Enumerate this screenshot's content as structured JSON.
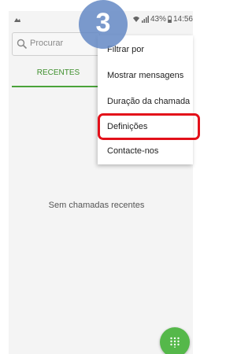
{
  "status_bar": {
    "battery_percent": "43%",
    "time": "14:56",
    "left_icon": "notification-icon",
    "wifi_icon": "wifi-icon",
    "signal_icon": "signal-icon",
    "battery_icon": "battery-icon"
  },
  "search": {
    "placeholder": "Procurar",
    "icon": "search-icon"
  },
  "tabs": [
    {
      "label": "RECENTES",
      "selected": true
    }
  ],
  "empty_state": {
    "message": "Sem chamadas recentes"
  },
  "menu": {
    "items": [
      {
        "label": "Filtrar por"
      },
      {
        "label": "Mostrar mensagens"
      },
      {
        "label": "Duração da chamada"
      },
      {
        "label": "Definições",
        "highlighted": true
      },
      {
        "label": "Contacte-nos"
      }
    ]
  },
  "step_badge": {
    "number": "3"
  },
  "fab": {
    "icon": "dialpad-icon"
  },
  "colors": {
    "accent_green": "#4aa33a",
    "fab_green": "#55b84a",
    "highlight_red": "#e3101a",
    "badge_blue": "#6488c4"
  }
}
